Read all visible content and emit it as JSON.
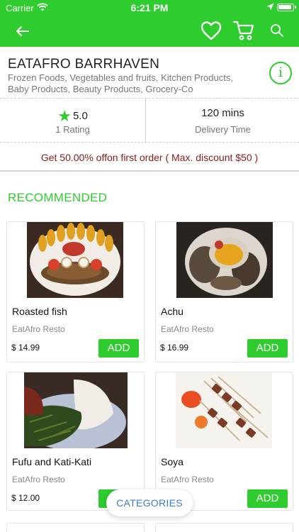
{
  "status_bar": {
    "carrier": "Carrier",
    "time": "6:21 PM"
  },
  "nav": {
    "icons": [
      "back-arrow-icon",
      "heart-icon",
      "cart-icon",
      "search-icon"
    ]
  },
  "store": {
    "name": "EATAFRO BARRHAVEN",
    "categories": "Frozen Foods, Vegetables and fruits, Kitchen Products, Baby Products, Beauty Products, Grocery-Co",
    "rating_value": "5.0",
    "rating_label": "1 Rating",
    "delivery_value": "120 mins",
    "delivery_label": "Delivery Time",
    "info_symbol": "i"
  },
  "offer": {
    "text": "Get 50.00% offon first order ( Max. discount $50 )"
  },
  "section": {
    "title": "RECOMMENDED"
  },
  "products": [
    {
      "name": "Roasted fish",
      "shop": "EatAfro Resto",
      "price": "$ 14.99",
      "add_label": "ADD"
    },
    {
      "name": "Achu",
      "shop": "EatAfro Resto",
      "price": "$ 16.99",
      "add_label": "ADD"
    },
    {
      "name": "Fufu and Kati-Kati",
      "shop": "EatAfro Resto",
      "price": "$ 12.00",
      "add_label": "ADD"
    },
    {
      "name": "Soya",
      "shop": "EatAfro Resto",
      "price": "",
      "add_label": "ADD"
    }
  ],
  "categories_button": {
    "label": "CATEGORIES"
  },
  "colors": {
    "brand_green": "#2ecc2e",
    "offer_red": "#8b1a1a",
    "link_blue": "#3a7bd5"
  }
}
